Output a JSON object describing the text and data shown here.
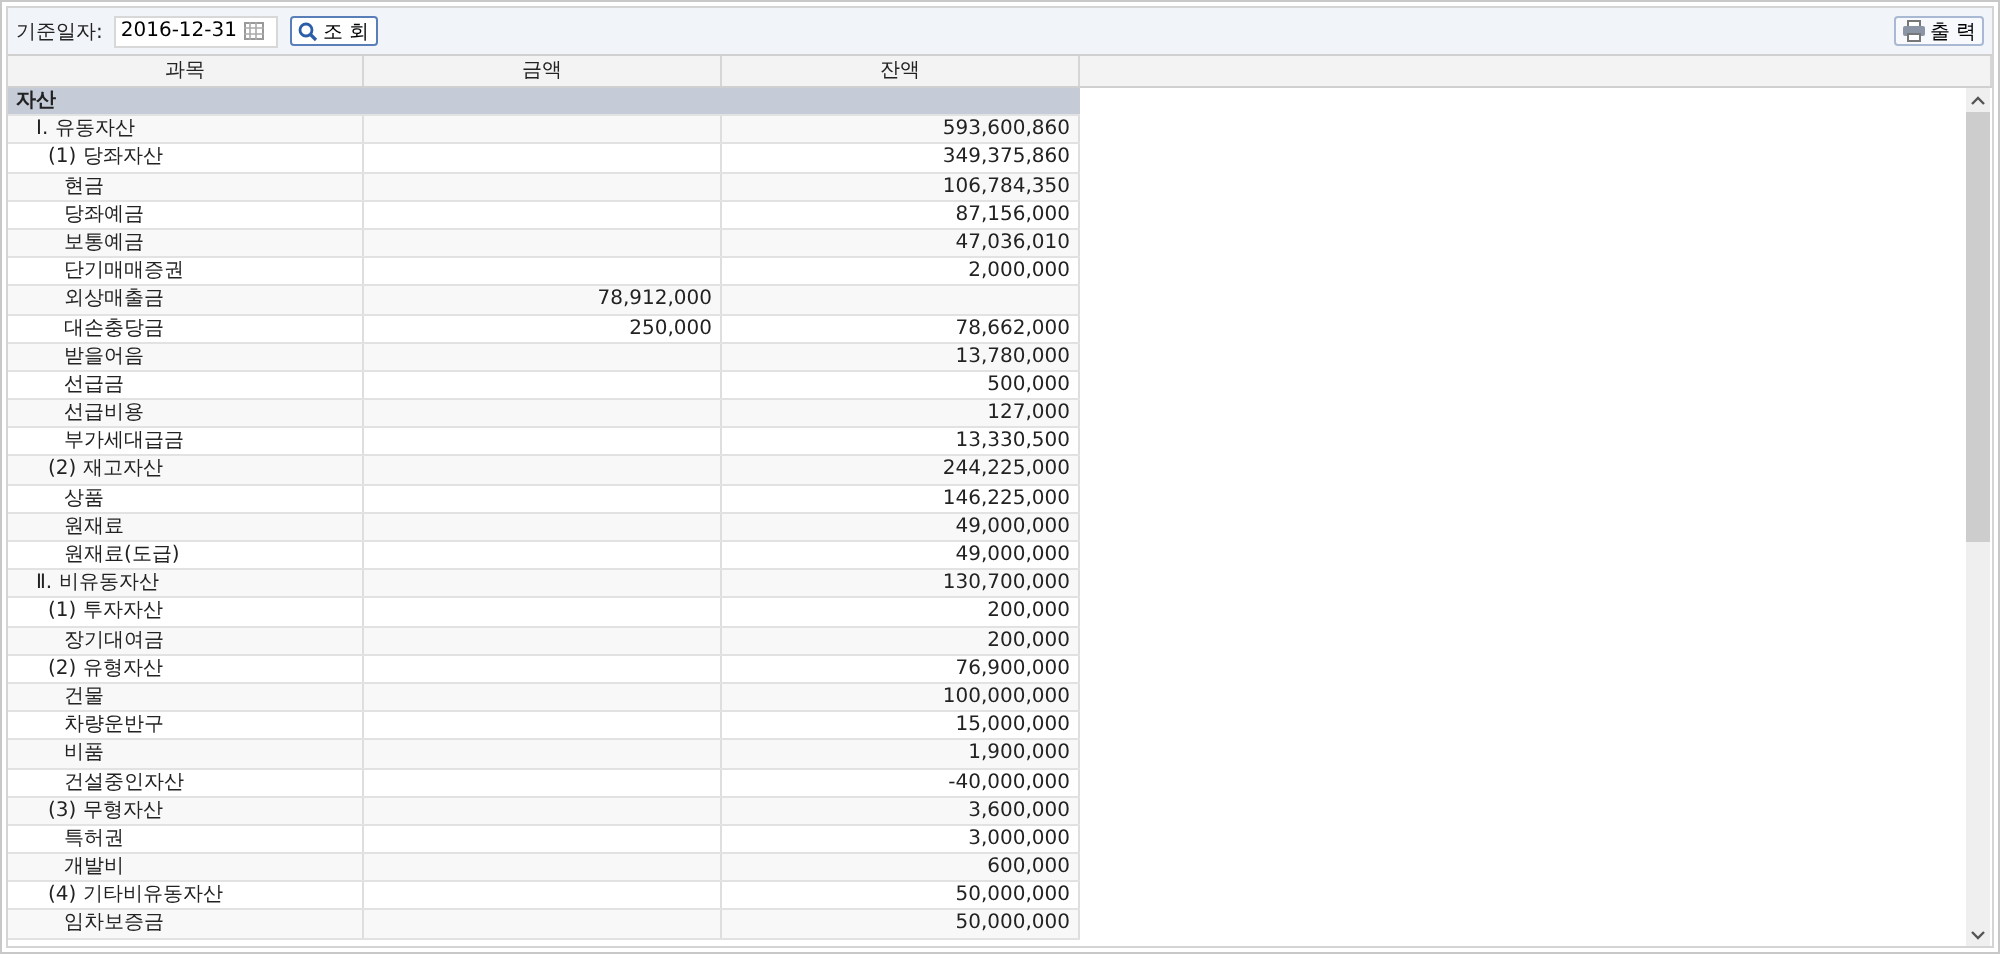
{
  "toolbar": {
    "date_label": "기준일자:",
    "date_value": "2016-12-31",
    "search_button": "조 회",
    "print_button": "출 력"
  },
  "table": {
    "columns": [
      "과목",
      "금액",
      "잔액"
    ],
    "rows": [
      {
        "name": "자산",
        "amount": "",
        "balance": "",
        "children": [
          {
            "name": "Ⅰ. 유동자산",
            "balance": "593,600,860",
            "children": [
              {
                "name": "(1) 당좌자산",
                "balance": "349,375,860",
                "children": [
                  {
                    "name": "현금",
                    "balance": "106,784,350"
                  },
                  {
                    "name": "당좌예금",
                    "balance": "87,156,000"
                  },
                  {
                    "name": "보통예금",
                    "balance": "47,036,010"
                  },
                  {
                    "name": "단기매매증권",
                    "balance": "2,000,000"
                  },
                  {
                    "name": "외상매출금",
                    "amount": "78,912,000"
                  },
                  {
                    "name": "대손충당금",
                    "amount": "250,000",
                    "balance": "78,662,000"
                  },
                  {
                    "name": "받을어음",
                    "balance": "13,780,000"
                  },
                  {
                    "name": "선급금",
                    "balance": "500,000"
                  },
                  {
                    "name": "선급비용",
                    "balance": "127,000"
                  },
                  {
                    "name": "부가세대급금",
                    "balance": "13,330,500"
                  }
                ]
              },
              {
                "name": "(2) 재고자산",
                "balance": "244,225,000",
                "children": [
                  {
                    "name": "상품",
                    "balance": "146,225,000"
                  },
                  {
                    "name": "원재료",
                    "balance": "49,000,000"
                  },
                  {
                    "name": "원재료(도급)",
                    "balance": "49,000,000"
                  }
                ]
              }
            ]
          },
          {
            "name": "Ⅱ. 비유동자산",
            "balance": "130,700,000",
            "children": [
              {
                "name": "(1) 투자자산",
                "balance": "200,000",
                "children": [
                  {
                    "name": "장기대여금",
                    "balance": "200,000"
                  }
                ]
              },
              {
                "name": "(2) 유형자산",
                "balance": "76,900,000",
                "children": [
                  {
                    "name": "건물",
                    "balance": "100,000,000"
                  },
                  {
                    "name": "차량운반구",
                    "balance": "15,000,000"
                  },
                  {
                    "name": "비품",
                    "balance": "1,900,000"
                  },
                  {
                    "name": "건설중인자산",
                    "balance": "-40,000,000"
                  }
                ]
              },
              {
                "name": "(3) 무형자산",
                "balance": "3,600,000",
                "children": [
                  {
                    "name": "특허권",
                    "balance": "3,000,000"
                  },
                  {
                    "name": "개발비",
                    "balance": "600,000"
                  }
                ]
              },
              {
                "name": "(4) 기타비유동자산",
                "balance": "50,000,000",
                "children": [
                  {
                    "name": "임차보증금",
                    "balance": "50,000,000"
                  }
                ]
              }
            ]
          }
        ]
      }
    ]
  }
}
